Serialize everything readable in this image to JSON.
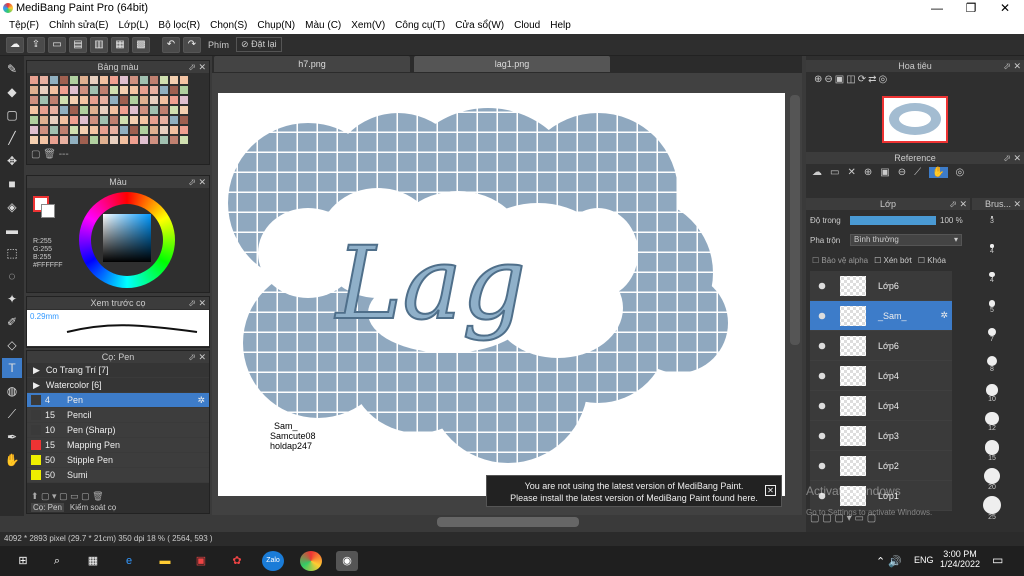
{
  "window": {
    "title": "MediBang Paint Pro (64bit)",
    "min": "—",
    "max": "❐",
    "close": "✕"
  },
  "menu": [
    "Tệp(F)",
    "Chỉnh sửa(E)",
    "Lớp(L)",
    "Bộ lọc(R)",
    "Chọn(S)",
    "Chụp(N)",
    "Màu (C)",
    "Xem(V)",
    "Công cụ(T)",
    "Cửa sổ(W)",
    "Cloud",
    "Help"
  ],
  "toolbar": {
    "pen_mode": "Phím",
    "reset": "Đặt lại"
  },
  "swatches": {
    "title": "Bảng màu"
  },
  "color": {
    "title": "Màu",
    "rgb_r": "R:255",
    "rgb_g": "G:255",
    "rgb_b": "B:255",
    "hex": "#FFFFFF"
  },
  "brush_preview": {
    "title": "Xem trước cọ",
    "size": "0.29mm"
  },
  "brush_panel": {
    "title": "Cọ: Pen",
    "groups": [
      "Co Trang Trí [7]",
      "Watercolor [6]"
    ],
    "items": [
      {
        "num": "4",
        "name": "Pen",
        "color": "#3a3a3a",
        "sel": true
      },
      {
        "num": "15",
        "name": "Pencil",
        "color": "#3a3a3a"
      },
      {
        "num": "10",
        "name": "Pen (Sharp)",
        "color": "#3a3a3a"
      },
      {
        "num": "15",
        "name": "Mapping Pen",
        "color": "#e33"
      },
      {
        "num": "50",
        "name": "Stipple Pen",
        "color": "#ee0"
      },
      {
        "num": "50",
        "name": "Sumi",
        "color": "#ee0"
      }
    ],
    "tabs": [
      "Cọ: Pen",
      "Kiểm soát cọ"
    ]
  },
  "tabs": [
    "h7.png",
    "lag1.png"
  ],
  "canvas": {
    "lettering": "Lag",
    "sig1": "Sam_",
    "sig2": "Samcute08",
    "sig3": "holdap247"
  },
  "notice": {
    "line1": "You are not using the latest version of MediBang Paint.",
    "line2": "Please install the latest version of MediBang Paint found here.",
    "close": "✕"
  },
  "status": "4092 * 2893 pixel  (29.7 * 21cm)  350 dpi  18 %  ( 2564, 593 )",
  "navigator": {
    "title": "Hoa tiêu"
  },
  "reference": {
    "title": "Reference"
  },
  "layers": {
    "title": "Lớp",
    "opacity_label": "Độ trong",
    "opacity_value": "100 %",
    "blend_label": "Pha trộn",
    "blend_value": "Bình thường",
    "protect": "Bảo vệ alpha",
    "clip": "Xén bớt",
    "lock": "Khóa",
    "items": [
      "Lớp6",
      "_Sam_",
      "Lớp6",
      "Lớp4",
      "Lớp4",
      "Lớp3",
      "Lớp2",
      "Lớp1"
    ]
  },
  "brushsize": {
    "title": "Brus...",
    "sizes": [
      "3",
      "4",
      "4",
      "5",
      "7",
      "8",
      "10",
      "12",
      "15",
      "20",
      "25"
    ]
  },
  "activate": {
    "line1": "Activate Windows",
    "line2": "Go to Settings to activate Windows."
  },
  "tray": {
    "lang": "ENG",
    "time": "3:00 PM",
    "date": "1/24/2022"
  }
}
